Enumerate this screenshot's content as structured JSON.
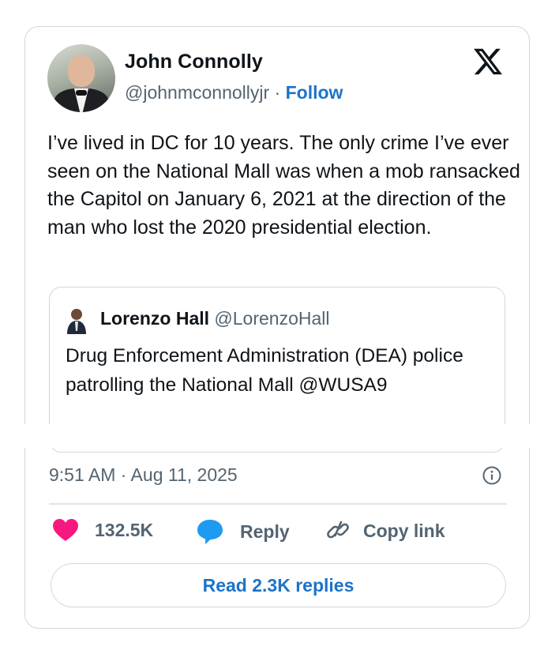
{
  "author": {
    "name": "John Connolly",
    "handle": "@johnmconnollyjr",
    "separator": "·",
    "follow_label": "Follow",
    "avatar_icon": "profile-photo"
  },
  "brand_icon": "x-logo-icon",
  "tweet": {
    "text": "I’ve lived in DC for 10 years. The only crime I’ve ever seen on the National Mall was when a mob ransacked the Capitol on January 6, 2021 at the direction of the man who lost the 2020 presidential election."
  },
  "quote": {
    "name": "Lorenzo Hall",
    "handle": "@LorenzoHall",
    "text": "Drug Enforcement Administration (DEA) police patrolling the National Mall @WUSA9"
  },
  "meta": {
    "timestamp": "9:51 AM · Aug 11, 2025"
  },
  "actions": {
    "likes": "132.5K",
    "reply_label": "Reply",
    "copy_label": "Copy link"
  },
  "read_replies_label": "Read 2.3K replies",
  "colors": {
    "accent": "#1d73c9",
    "like": "#f91880",
    "reply": "#1d9bf0",
    "muted": "#536471",
    "border": "#cfd9de"
  }
}
